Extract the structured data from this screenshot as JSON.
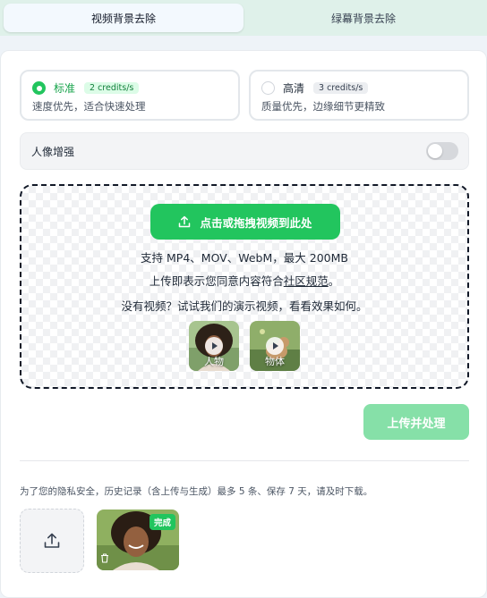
{
  "tabs": [
    {
      "label": "视频背景去除",
      "active": true
    },
    {
      "label": "绿幕背景去除",
      "active": false
    }
  ],
  "quality": {
    "standard": {
      "name": "标准",
      "badge": "2 credits/s",
      "desc": "速度优先，适合快速处理",
      "selected": true
    },
    "hd": {
      "name": "高清",
      "badge": "3 credits/s",
      "desc": "质量优先，边缘细节更精致",
      "selected": false
    }
  },
  "portrait_enhance": {
    "label": "人像增强",
    "enabled": false
  },
  "dropzone": {
    "button_label": "点击或拖拽视频到此处",
    "formats": "支持 MP4、MOV、WebM，最大 200MB",
    "terms_prefix": "上传即表示您同意内容符合",
    "terms_link": "社区规范",
    "terms_suffix": "。",
    "samples_prompt": "没有视频？试试我们的演示视频，看看效果如何。",
    "samples": [
      {
        "label": "人物",
        "icon": "play-icon"
      },
      {
        "label": "物体",
        "icon": "play-icon"
      }
    ]
  },
  "actions": {
    "process_label": "上传并处理"
  },
  "history": {
    "privacy_note": "为了您的隐私安全，历史记录（含上传与生成）最多 5 条、保存 7 天，请及时下载。",
    "items": [
      {
        "status": "完成"
      }
    ]
  },
  "colors": {
    "accent": "#22c55e",
    "accent_disabled": "#86e0a8",
    "tab_bar": "#dff1ea"
  }
}
